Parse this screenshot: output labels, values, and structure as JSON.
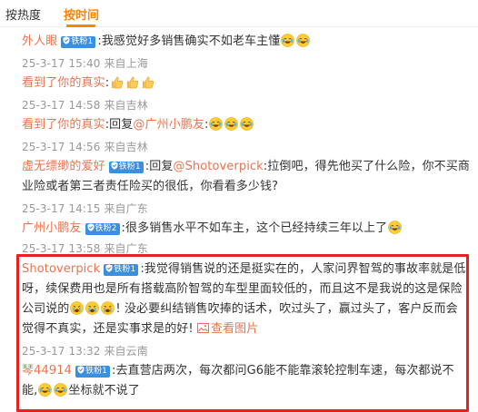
{
  "tabs": [
    {
      "label": "按热度"
    },
    {
      "label": "按时间"
    }
  ],
  "colors": {
    "username": "#eb7350",
    "active_tab": "#ff8200",
    "badge": "#3b8fe0",
    "meta": "#999999",
    "highlight_box": "#e6211f"
  },
  "icons": {
    "badge": "fan-badge-icon",
    "emoji_laugh_cry": "laugh-cry-emoji",
    "emoji_thumbs_up": "thumbs-up-emoji",
    "emoji_cry": "cry-emoji",
    "picture": "picture-icon"
  },
  "comments": [
    {
      "user": "外人眼",
      "badge": "铁粉1",
      "text": ":我感觉好多销售确实不如老车主懂",
      "meta": "25-3-17 15:40 来自上海"
    },
    {
      "user": "看到了你的真实",
      "text": ":",
      "meta": "25-3-17 14:58 来自吉林"
    },
    {
      "user": "看到了你的真实",
      "text_prefix": ":回复",
      "mention": "@广州小鹏友",
      "text": ":",
      "meta": "25-3-17 14:56 来自吉林"
    },
    {
      "user": "虚无缥缈的爱好",
      "badge": "铁粉1",
      "text_prefix": ":回复",
      "mention": "@Shotoverpick",
      "text_l1": ":拉倒吧，得先他买了什么险，你不买商",
      "text_l2": "业险或者第三者责任险买的很低，你看看多少钱?",
      "meta": "25-3-17 14:15 来自广东"
    },
    {
      "user": "广州小鹏友",
      "badge": "铁粉2",
      "text": ":很多销售水平不如车主，这个已经持续三年以上了",
      "meta": "25-3-17 13:58 来自广东"
    },
    {
      "user": "Shotoverpick",
      "badge": "铁粉1",
      "text_l1": ":我觉得销售说的还是挺实在的，人家问界智驾的事故率就是低",
      "text_l2": "呀，续保费用也是所有搭载高阶智驾的车型里面较低的，而且这不是我说的这是保险",
      "text_l3a": "公司说的",
      "text_l3b": "! 没必要纠结销售吹捧的话术，吹过头了，赢过头了，客户反而会",
      "text_l4": "觉得不真实，还是实事求是的好!",
      "view_image": "查看图片",
      "meta": "25-3-17 13:32 来自云南"
    },
    {
      "user": "琴44914",
      "badge": "铁粉1",
      "text_l1": ":去直营店两次，每次都问G6能不能靠滚轮控制车速，每次都说不",
      "text_l2a": "能,",
      "text_l2b": "坐标就不说了"
    }
  ]
}
